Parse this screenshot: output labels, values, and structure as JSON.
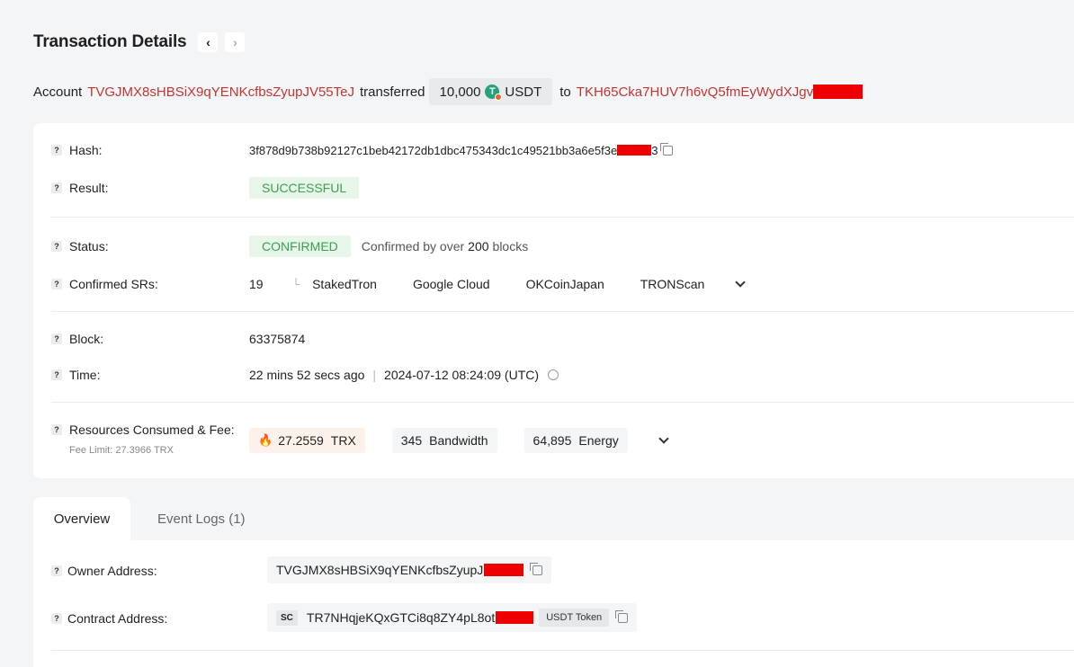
{
  "header": {
    "title": "Transaction Details"
  },
  "summary": {
    "account_label": "Account",
    "from_address": "TVGJMX8sHBSiX9qYENKcfbsZyupJV55TeJ",
    "transferred_label": "transferred",
    "amount": "10,000",
    "token": "USDT",
    "to_label": "to",
    "to_address": "TKH65Cka7HUV7h6vQ5fmEyWydXJgv"
  },
  "details": {
    "hash_label": "Hash:",
    "hash_value": "3f878d9b738b92127c1beb42172db1dbc475343dc1c49521bb3a6e5f3e",
    "hash_tail": "3",
    "result_label": "Result:",
    "result_value": "SUCCESSFUL",
    "status_label": "Status:",
    "status_value": "CONFIRMED",
    "confirmed_prefix": "Confirmed by over",
    "confirmed_count": "200",
    "confirmed_suffix": "blocks",
    "srs_label": "Confirmed SRs:",
    "srs_count": "19",
    "srs": [
      "StakedTron",
      "Google Cloud",
      "OKCoinJapan",
      "TRONScan"
    ],
    "block_label": "Block:",
    "block_value": "63375874",
    "time_label": "Time:",
    "time_ago": "22 mins 52 secs ago",
    "time_utc": "2024-07-12 08:24:09 (UTC)",
    "resources_label": "Resources Consumed & Fee:",
    "fee_limit": "Fee Limit: 27.3966 TRX",
    "fee_value": "27.2559",
    "fee_unit": "TRX",
    "bandwidth_value": "345",
    "bandwidth_unit": "Bandwidth",
    "energy_value": "64,895",
    "energy_unit": "Energy"
  },
  "tabs": [
    {
      "label": "Overview"
    },
    {
      "label": "Event Logs (1)"
    }
  ],
  "overview": {
    "owner_label": "Owner Address:",
    "owner_value": "TVGJMX8sHBSiX9qYENKcfbsZyupJ",
    "contract_label": "Contract Address:",
    "contract_badge": "SC",
    "contract_value": "TR7NHqjeKQxGTCi8q8ZY4pL8ot",
    "contract_token": "USDT Token"
  },
  "colors": {
    "address_red": "#c23631",
    "success_green": "#3aa14c",
    "fire_orange": "#e8622e"
  }
}
